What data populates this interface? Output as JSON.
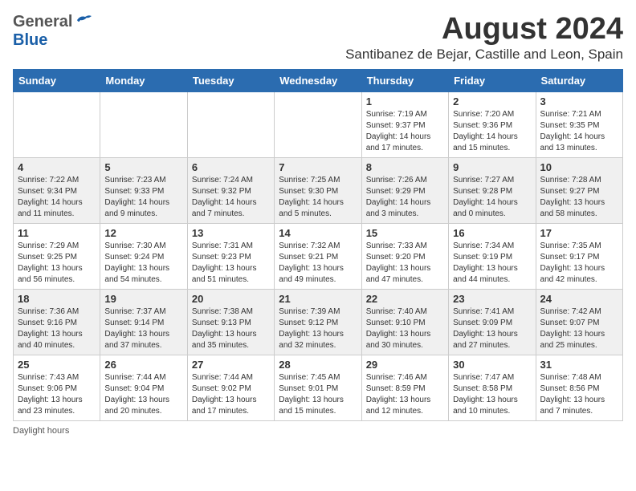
{
  "logo": {
    "general": "General",
    "blue": "Blue"
  },
  "title": "August 2024",
  "subtitle": "Santibanez de Bejar, Castille and Leon, Spain",
  "weekdays": [
    "Sunday",
    "Monday",
    "Tuesday",
    "Wednesday",
    "Thursday",
    "Friday",
    "Saturday"
  ],
  "weeks": [
    [
      {
        "day": "",
        "info": ""
      },
      {
        "day": "",
        "info": ""
      },
      {
        "day": "",
        "info": ""
      },
      {
        "day": "",
        "info": ""
      },
      {
        "day": "1",
        "info": "Sunrise: 7:19 AM\nSunset: 9:37 PM\nDaylight: 14 hours\nand 17 minutes."
      },
      {
        "day": "2",
        "info": "Sunrise: 7:20 AM\nSunset: 9:36 PM\nDaylight: 14 hours\nand 15 minutes."
      },
      {
        "day": "3",
        "info": "Sunrise: 7:21 AM\nSunset: 9:35 PM\nDaylight: 14 hours\nand 13 minutes."
      }
    ],
    [
      {
        "day": "4",
        "info": "Sunrise: 7:22 AM\nSunset: 9:34 PM\nDaylight: 14 hours\nand 11 minutes."
      },
      {
        "day": "5",
        "info": "Sunrise: 7:23 AM\nSunset: 9:33 PM\nDaylight: 14 hours\nand 9 minutes."
      },
      {
        "day": "6",
        "info": "Sunrise: 7:24 AM\nSunset: 9:32 PM\nDaylight: 14 hours\nand 7 minutes."
      },
      {
        "day": "7",
        "info": "Sunrise: 7:25 AM\nSunset: 9:30 PM\nDaylight: 14 hours\nand 5 minutes."
      },
      {
        "day": "8",
        "info": "Sunrise: 7:26 AM\nSunset: 9:29 PM\nDaylight: 14 hours\nand 3 minutes."
      },
      {
        "day": "9",
        "info": "Sunrise: 7:27 AM\nSunset: 9:28 PM\nDaylight: 14 hours\nand 0 minutes."
      },
      {
        "day": "10",
        "info": "Sunrise: 7:28 AM\nSunset: 9:27 PM\nDaylight: 13 hours\nand 58 minutes."
      }
    ],
    [
      {
        "day": "11",
        "info": "Sunrise: 7:29 AM\nSunset: 9:25 PM\nDaylight: 13 hours\nand 56 minutes."
      },
      {
        "day": "12",
        "info": "Sunrise: 7:30 AM\nSunset: 9:24 PM\nDaylight: 13 hours\nand 54 minutes."
      },
      {
        "day": "13",
        "info": "Sunrise: 7:31 AM\nSunset: 9:23 PM\nDaylight: 13 hours\nand 51 minutes."
      },
      {
        "day": "14",
        "info": "Sunrise: 7:32 AM\nSunset: 9:21 PM\nDaylight: 13 hours\nand 49 minutes."
      },
      {
        "day": "15",
        "info": "Sunrise: 7:33 AM\nSunset: 9:20 PM\nDaylight: 13 hours\nand 47 minutes."
      },
      {
        "day": "16",
        "info": "Sunrise: 7:34 AM\nSunset: 9:19 PM\nDaylight: 13 hours\nand 44 minutes."
      },
      {
        "day": "17",
        "info": "Sunrise: 7:35 AM\nSunset: 9:17 PM\nDaylight: 13 hours\nand 42 minutes."
      }
    ],
    [
      {
        "day": "18",
        "info": "Sunrise: 7:36 AM\nSunset: 9:16 PM\nDaylight: 13 hours\nand 40 minutes."
      },
      {
        "day": "19",
        "info": "Sunrise: 7:37 AM\nSunset: 9:14 PM\nDaylight: 13 hours\nand 37 minutes."
      },
      {
        "day": "20",
        "info": "Sunrise: 7:38 AM\nSunset: 9:13 PM\nDaylight: 13 hours\nand 35 minutes."
      },
      {
        "day": "21",
        "info": "Sunrise: 7:39 AM\nSunset: 9:12 PM\nDaylight: 13 hours\nand 32 minutes."
      },
      {
        "day": "22",
        "info": "Sunrise: 7:40 AM\nSunset: 9:10 PM\nDaylight: 13 hours\nand 30 minutes."
      },
      {
        "day": "23",
        "info": "Sunrise: 7:41 AM\nSunset: 9:09 PM\nDaylight: 13 hours\nand 27 minutes."
      },
      {
        "day": "24",
        "info": "Sunrise: 7:42 AM\nSunset: 9:07 PM\nDaylight: 13 hours\nand 25 minutes."
      }
    ],
    [
      {
        "day": "25",
        "info": "Sunrise: 7:43 AM\nSunset: 9:06 PM\nDaylight: 13 hours\nand 23 minutes."
      },
      {
        "day": "26",
        "info": "Sunrise: 7:44 AM\nSunset: 9:04 PM\nDaylight: 13 hours\nand 20 minutes."
      },
      {
        "day": "27",
        "info": "Sunrise: 7:44 AM\nSunset: 9:02 PM\nDaylight: 13 hours\nand 17 minutes."
      },
      {
        "day": "28",
        "info": "Sunrise: 7:45 AM\nSunset: 9:01 PM\nDaylight: 13 hours\nand 15 minutes."
      },
      {
        "day": "29",
        "info": "Sunrise: 7:46 AM\nSunset: 8:59 PM\nDaylight: 13 hours\nand 12 minutes."
      },
      {
        "day": "30",
        "info": "Sunrise: 7:47 AM\nSunset: 8:58 PM\nDaylight: 13 hours\nand 10 minutes."
      },
      {
        "day": "31",
        "info": "Sunrise: 7:48 AM\nSunset: 8:56 PM\nDaylight: 13 hours\nand 7 minutes."
      }
    ]
  ],
  "footer": "Daylight hours"
}
